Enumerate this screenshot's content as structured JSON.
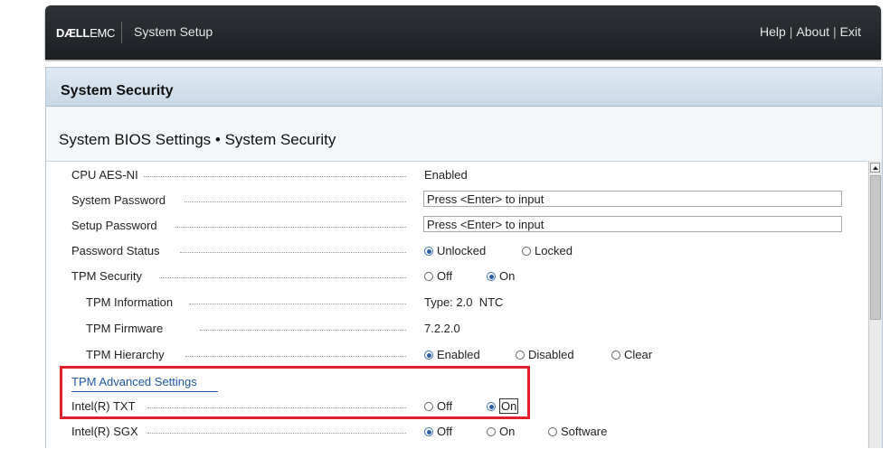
{
  "header": {
    "brand_bold": "DÆLL",
    "brand_rest": "EMC",
    "app_title": "System Setup",
    "help": "Help",
    "about": "About",
    "exit": "Exit",
    "separator": "|"
  },
  "panel": {
    "title": "System Security",
    "breadcrumb": "System BIOS Settings • System Security"
  },
  "settings": {
    "cpu_aes": {
      "label": "CPU AES-NI",
      "value": "Enabled"
    },
    "system_password": {
      "label": "System Password",
      "value": "Press <Enter> to input"
    },
    "setup_password": {
      "label": "Setup Password",
      "value": "Press <Enter> to input"
    },
    "password_status": {
      "label": "Password Status",
      "opt1": "Unlocked",
      "opt2": "Locked",
      "selected": "Unlocked"
    },
    "tpm_security": {
      "label": "TPM Security",
      "opt1": "Off",
      "opt2": "On",
      "selected": "On"
    },
    "tpm_information": {
      "label": "TPM Information",
      "value": "Type: 2.0  NTC"
    },
    "tpm_firmware": {
      "label": "TPM Firmware",
      "value": "7.2.2.0"
    },
    "tpm_hierarchy": {
      "label": "TPM Hierarchy",
      "opt1": "Enabled",
      "opt2": "Disabled",
      "opt3": "Clear",
      "selected": "Enabled"
    },
    "tpm_advanced": {
      "label": "TPM Advanced Settings"
    },
    "intel_txt": {
      "label": "Intel(R) TXT",
      "opt1": "Off",
      "opt2": "On",
      "selected": "On"
    },
    "intel_sgx": {
      "label": "Intel(R) SGX",
      "opt1": "Off",
      "opt2": "On",
      "opt3": "Software",
      "selected": "Off"
    }
  },
  "colors": {
    "header_bg": "#24282d",
    "accent": "#1f57a4",
    "highlight": "#e0202a"
  }
}
